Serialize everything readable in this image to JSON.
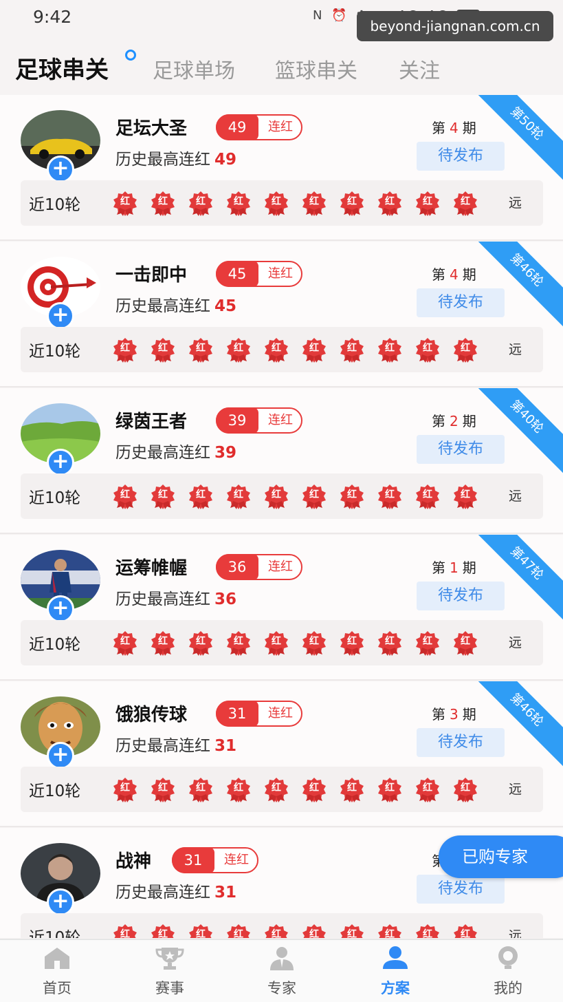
{
  "status_bar": {
    "time": "9:42",
    "icons": "N ⏰ ✱ ▤ 4G 4G",
    "battery": "87"
  },
  "watermark": "beyond-jiangnan.com.cn",
  "tabs": [
    {
      "label": "足球串关",
      "active": true
    },
    {
      "label": "足球单场",
      "active": false
    },
    {
      "label": "篮球串关",
      "active": false
    },
    {
      "label": "关注",
      "active": false
    }
  ],
  "common": {
    "streak_label": "连红",
    "history_label": "历史最高连红",
    "period_prefix": "第",
    "period_suffix": "期",
    "pending_label": "待发布",
    "rounds_label": "近10轮",
    "rounds_more": "远",
    "red_label": "红",
    "add_label": "+"
  },
  "experts": [
    {
      "name": "足坛大圣",
      "streak": "49",
      "history": "49",
      "period": "4",
      "ribbon": "第50轮",
      "avatar": "car"
    },
    {
      "name": "一击即中",
      "streak": "45",
      "history": "45",
      "period": "4",
      "ribbon": "第46轮",
      "avatar": "target"
    },
    {
      "name": "绿茵王者",
      "streak": "39",
      "history": "39",
      "period": "2",
      "ribbon": "第40轮",
      "avatar": "field"
    },
    {
      "name": "运筹帷幄",
      "streak": "36",
      "history": "36",
      "period": "1",
      "ribbon": "第47轮",
      "avatar": "player"
    },
    {
      "name": "饿狼传球",
      "streak": "31",
      "history": "31",
      "period": "3",
      "ribbon": "第46轮",
      "avatar": "cartoon"
    },
    {
      "name": "战神",
      "streak": "31",
      "history": "31",
      "period": "",
      "ribbon": "",
      "avatar": "man"
    }
  ],
  "float_button": "已购专家",
  "bottom_nav": [
    {
      "label": "首页",
      "icon": "home-icon",
      "active": false
    },
    {
      "label": "赛事",
      "icon": "trophy-icon",
      "active": false
    },
    {
      "label": "专家",
      "icon": "expert-icon",
      "active": false
    },
    {
      "label": "方案",
      "icon": "plan-icon",
      "active": true
    },
    {
      "label": "我的",
      "icon": "profile-icon",
      "active": false
    }
  ],
  "colors": {
    "accent": "#2f8af5",
    "red": "#e83b3b",
    "ribbon": "#2f9df5"
  }
}
